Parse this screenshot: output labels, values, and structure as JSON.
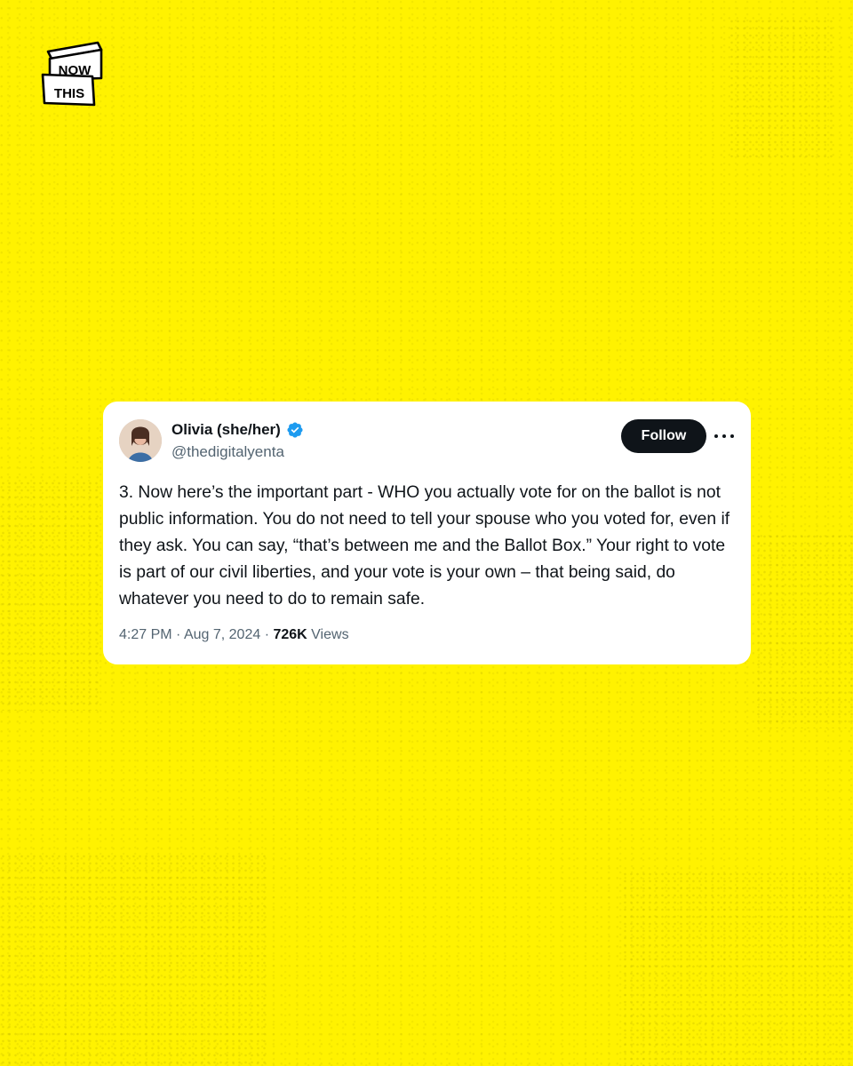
{
  "brand": {
    "logo_word_top": "NOW",
    "logo_word_bottom": "THIS"
  },
  "colors": {
    "background": "#fff200",
    "card": "#ffffff",
    "text_primary": "#0f1419",
    "text_secondary": "#536471",
    "follow_button": "#0f1419",
    "verified_badge": "#1d9bf0"
  },
  "tweet": {
    "author": {
      "display_name": "Olivia (she/her)",
      "handle": "@thedigitalyenta",
      "verified": true
    },
    "follow_label": "Follow",
    "more_icon": "more-horizontal-icon",
    "text": "3. Now here’s the important part - WHO you actually vote for on the ballot is not public information. You do not need to tell your spouse who you voted for, even if they ask. You can say, “that’s between me and the Ballot Box.” Your right to vote is part of our civil liberties, and your vote is your own – that being said, do whatever you need to do to remain safe.",
    "time": "4:27 PM",
    "separator": "·",
    "date": "Aug 7, 2024",
    "views_count": "726K",
    "views_label": "Views"
  }
}
